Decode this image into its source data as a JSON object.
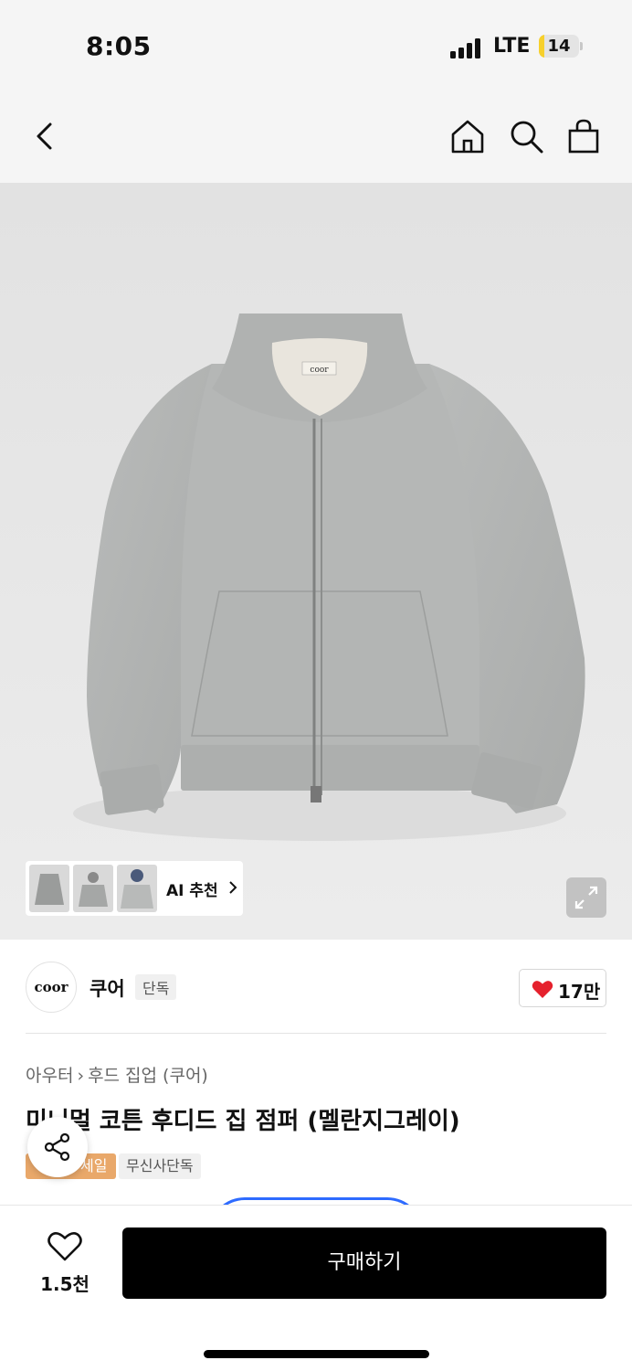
{
  "status_bar": {
    "time": "8:05",
    "network": "LTE",
    "battery": "14",
    "battery_level": 0.14,
    "battery_color": "#f7d02c"
  },
  "nav": {
    "back_icon": "chevron-left-icon",
    "home_icon": "home-icon",
    "search_icon": "search-icon",
    "cart_icon": "shopping-bag-icon"
  },
  "product_image": {
    "hoodie_label": "coor",
    "ai_recommend": "AI 추천",
    "expand_icon": "expand-icon"
  },
  "brand": {
    "logo_text": "coor",
    "name": "쿠어",
    "badge": "단독",
    "likes": "17만",
    "heart_color": "#e5212d"
  },
  "breadcrumb": {
    "category": "아우터",
    "subcategory": "후드 집업 (쿠어)"
  },
  "product": {
    "title": "미니멀 코튼 후디드 집 점퍼 (멜란지그레이)",
    "sale_badge": "세일",
    "exclusive_badge": "무신사단독",
    "sale_color": "#e9a86a"
  },
  "share_icon": "share-icon",
  "bottom": {
    "wish_count": "1.5천",
    "buy_label": "구매하기"
  }
}
